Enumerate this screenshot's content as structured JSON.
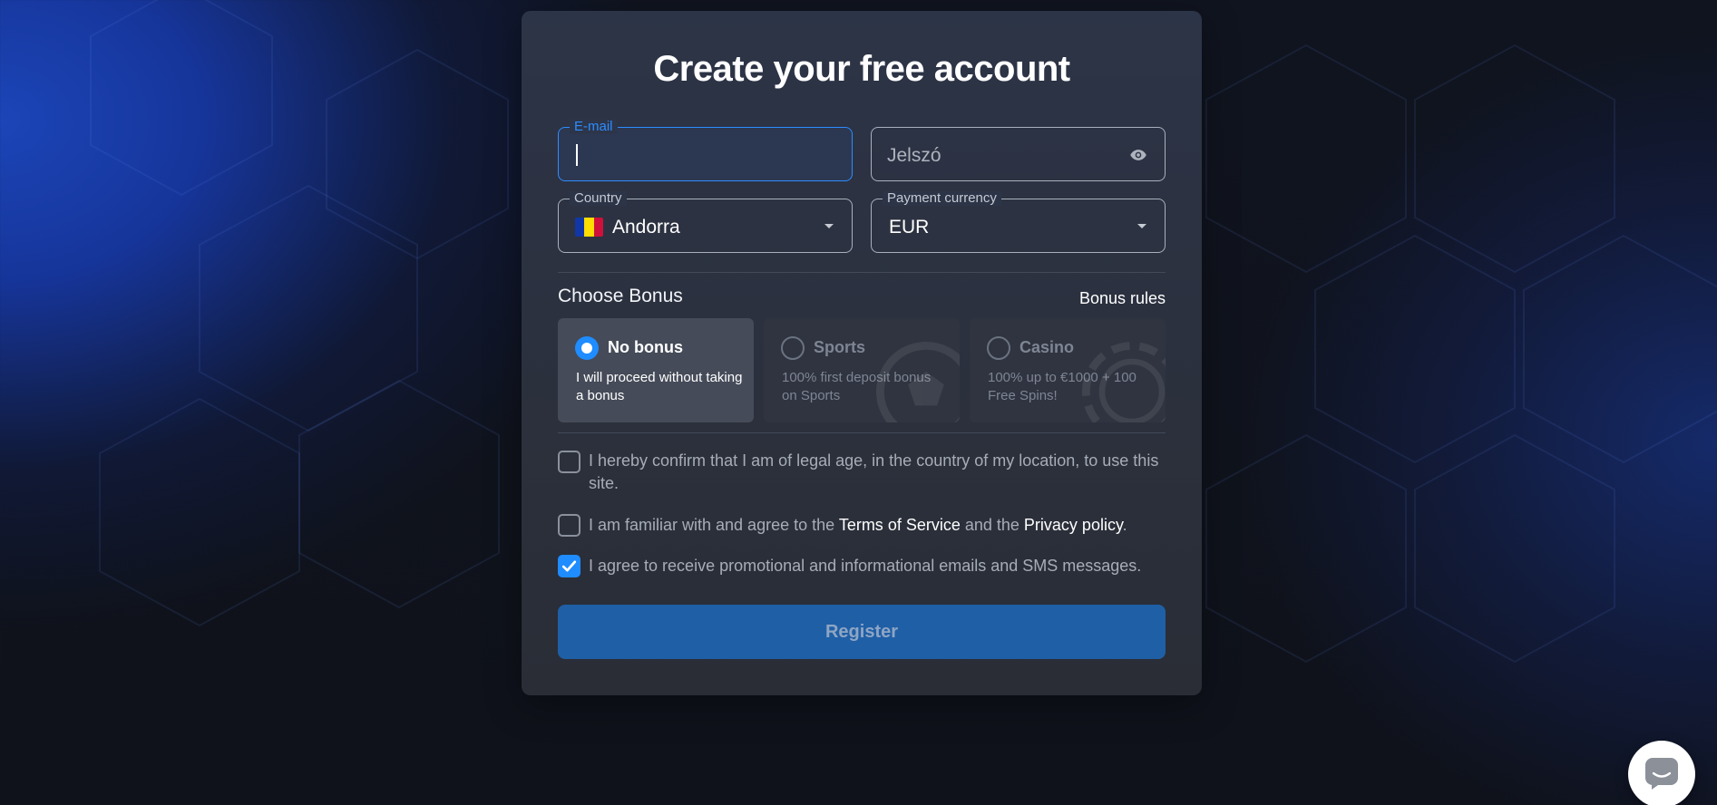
{
  "form": {
    "title": "Create your free account",
    "email": {
      "label": "E-mail",
      "value": ""
    },
    "password": {
      "placeholder": "Jelszó"
    },
    "country": {
      "label": "Country",
      "value": "Andorra",
      "flag_colors": [
        "#1136a6",
        "#fedd00",
        "#d0103a"
      ]
    },
    "currency": {
      "label": "Payment currency",
      "value": "EUR"
    }
  },
  "bonus": {
    "heading": "Choose Bonus",
    "rules_link": "Bonus rules",
    "options": [
      {
        "name": "No bonus",
        "description": "I will proceed without taking a bonus",
        "selected": true
      },
      {
        "name": "Sports",
        "description": "100% first deposit bonus on Sports",
        "selected": false
      },
      {
        "name": "Casino",
        "description": "100% up to €1000 + 100 Free Spins!",
        "selected": false
      }
    ]
  },
  "consents": {
    "legal_age": {
      "text": "I hereby confirm that I am of legal age, in the country of my location, to use this site.",
      "checked": false
    },
    "terms": {
      "prefix": "I am familiar with and agree to the ",
      "terms_link": "Terms of Service",
      "middle": " and the ",
      "privacy_link": "Privacy policy",
      "suffix": ".",
      "checked": false
    },
    "promo": {
      "text": "I agree to receive promotional and informational emails and SMS messages.",
      "checked": true
    }
  },
  "register_label": "Register",
  "colors": {
    "accent": "#1f8cff",
    "button": "#1f5fa6",
    "card": "#2b303c"
  },
  "icons": {
    "password_toggle": "eye-icon",
    "chat": "chat-icon"
  }
}
